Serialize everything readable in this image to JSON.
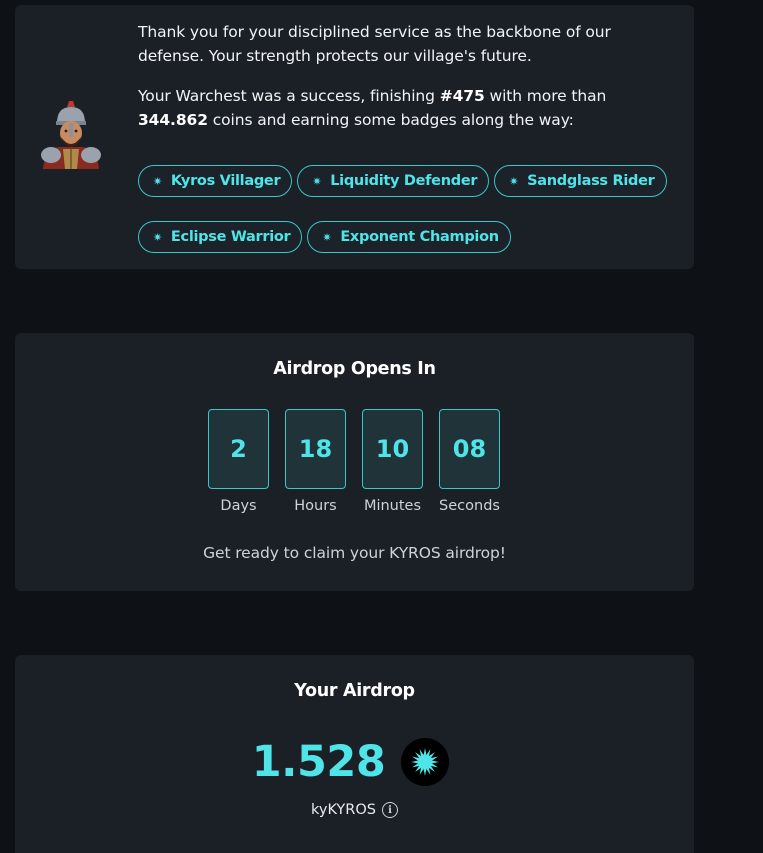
{
  "warchest": {
    "para1": "Thank you for your disciplined service as the backbone of our defense. Your strength protects our village's future.",
    "para2_prefix": "Your Warchest was a success, finishing ",
    "rank": "#475",
    "para2_middle": " with more than",
    "coins": "344.862",
    "para2_suffix": " coins and earning some badges along the way:",
    "badges": [
      {
        "label": "Kyros Villager"
      },
      {
        "label": "Liquidity Defender"
      },
      {
        "label": "Sandglass Rider"
      },
      {
        "label": "Eclipse Warrior"
      },
      {
        "label": "Exponent Champion"
      }
    ]
  },
  "countdown": {
    "title": "Airdrop Opens In",
    "units": [
      {
        "value": "2",
        "label": "Days"
      },
      {
        "value": "18",
        "label": "Hours"
      },
      {
        "value": "10",
        "label": "Minutes"
      },
      {
        "value": "08",
        "label": "Seconds"
      }
    ],
    "subtitle": "Get ready to claim your KYROS airdrop!"
  },
  "airdrop": {
    "title": "Your Airdrop",
    "amount": "1.528",
    "unit": "kyKYROS",
    "info_icon": "info-icon"
  },
  "colors": {
    "accent": "#4ee4e8",
    "background": "#0e1116",
    "card": "#1b1f26"
  }
}
